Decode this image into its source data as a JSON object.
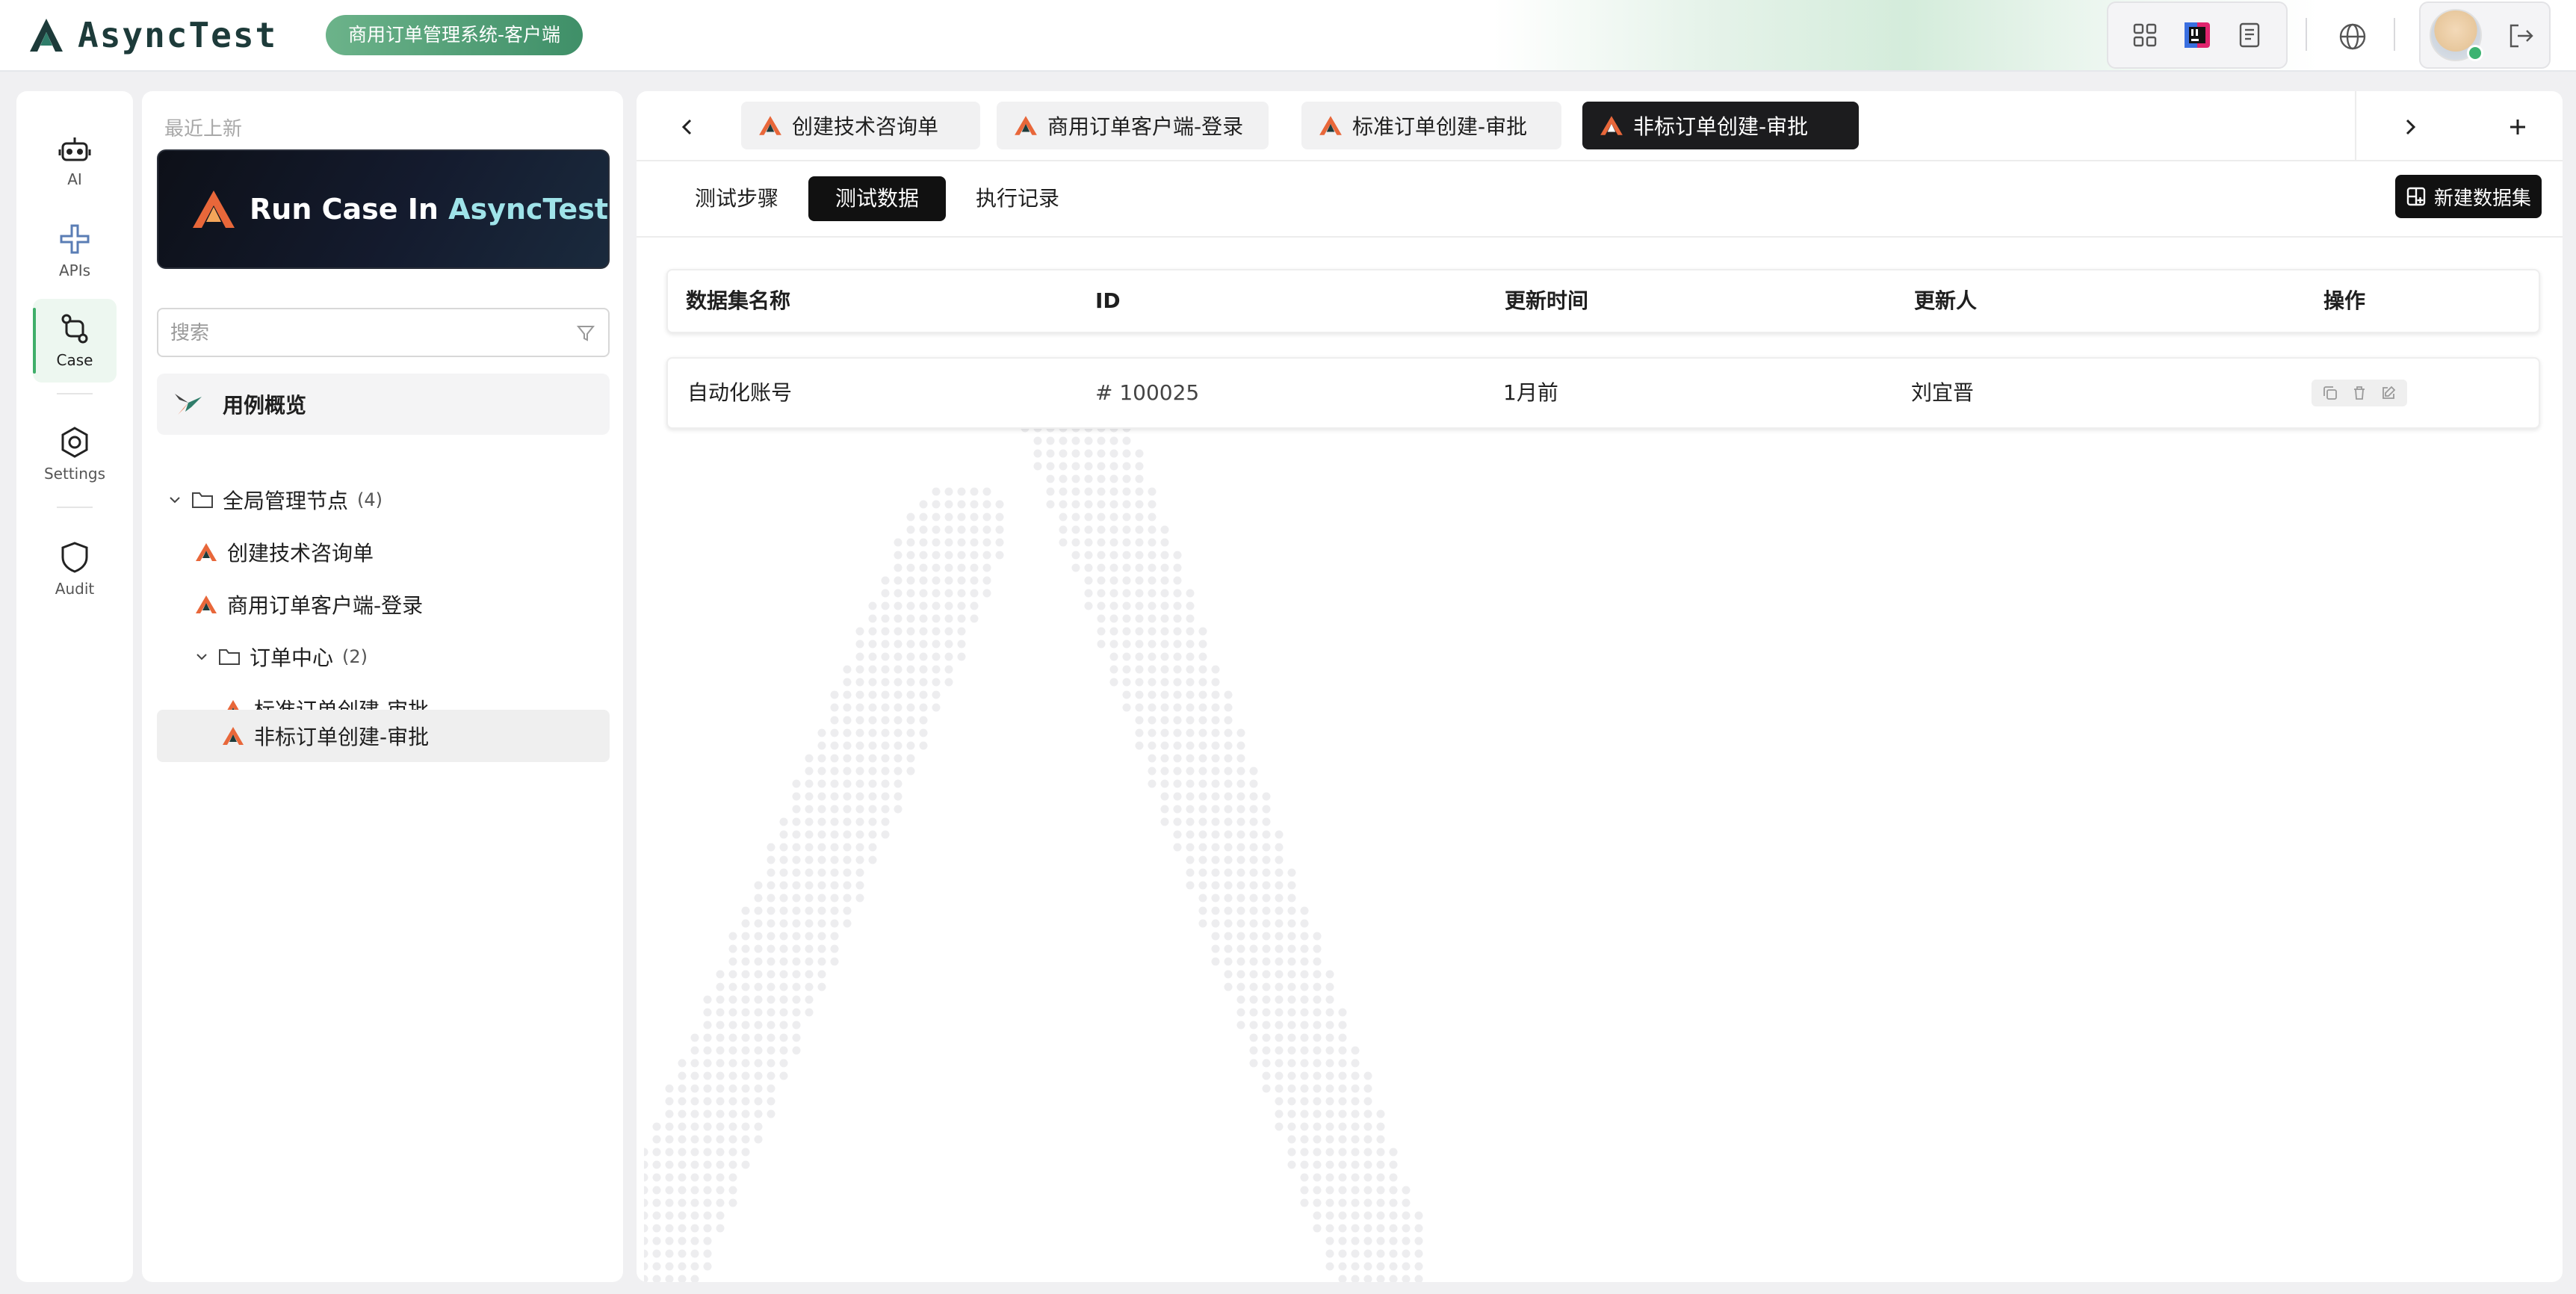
{
  "header": {
    "app_name": "AsyncTest",
    "project_name": "商用订单管理系统-客户端",
    "tools": [
      "apps-grid-icon",
      "intellij-icon",
      "document-icon"
    ],
    "language_icon": "globe-icon",
    "logout_icon": "logout-icon"
  },
  "rail": {
    "items": [
      {
        "label": "AI",
        "icon": "robot-icon"
      },
      {
        "label": "APIs",
        "icon": "api-icon"
      },
      {
        "label": "Case",
        "icon": "case-flow-icon",
        "active": true
      },
      {
        "label": "Settings",
        "icon": "gear-icon"
      },
      {
        "label": "Audit",
        "icon": "shield-icon"
      }
    ]
  },
  "tree": {
    "recent_label": "最近上新",
    "banner": {
      "prefix": "Run Case In ",
      "accent": "AsyncTest"
    },
    "search_placeholder": "搜索",
    "overview_label": "用例概览",
    "nodes": [
      {
        "type": "folder",
        "label": "全局管理节点",
        "count": "(4)",
        "expanded": true
      },
      {
        "type": "case",
        "label": "创建技术咨询单"
      },
      {
        "type": "case",
        "label": "商用订单客户端-登录"
      },
      {
        "type": "folder",
        "label": "订单中心",
        "count": "(2)",
        "expanded": true
      },
      {
        "type": "case",
        "label": "标准订单创建-审批"
      },
      {
        "type": "case",
        "label": "非标订单创建-审批",
        "selected": true
      }
    ]
  },
  "tabs": [
    {
      "label": "创建技术咨询单"
    },
    {
      "label": "商用订单客户端-登录"
    },
    {
      "label": "标准订单创建-审批"
    },
    {
      "label": "非标订单创建-审批",
      "active": true
    }
  ],
  "subtabs": [
    {
      "label": "测试步骤"
    },
    {
      "label": "测试数据",
      "active": true
    },
    {
      "label": "执行记录"
    }
  ],
  "new_dataset_label": "新建数据集",
  "table": {
    "columns": [
      "数据集名称",
      "ID",
      "更新时间",
      "更新人",
      "操作"
    ],
    "rows": [
      {
        "name": "自动化账号",
        "id": "# 100025",
        "updated": "1月前",
        "updater": "刘宜晋"
      }
    ],
    "action_icons": [
      "copy-icon",
      "delete-icon",
      "edit-icon"
    ]
  },
  "colors": {
    "accent_green": "#3fae6a",
    "logo_orange": "#e8673a",
    "dark": "#111111"
  }
}
